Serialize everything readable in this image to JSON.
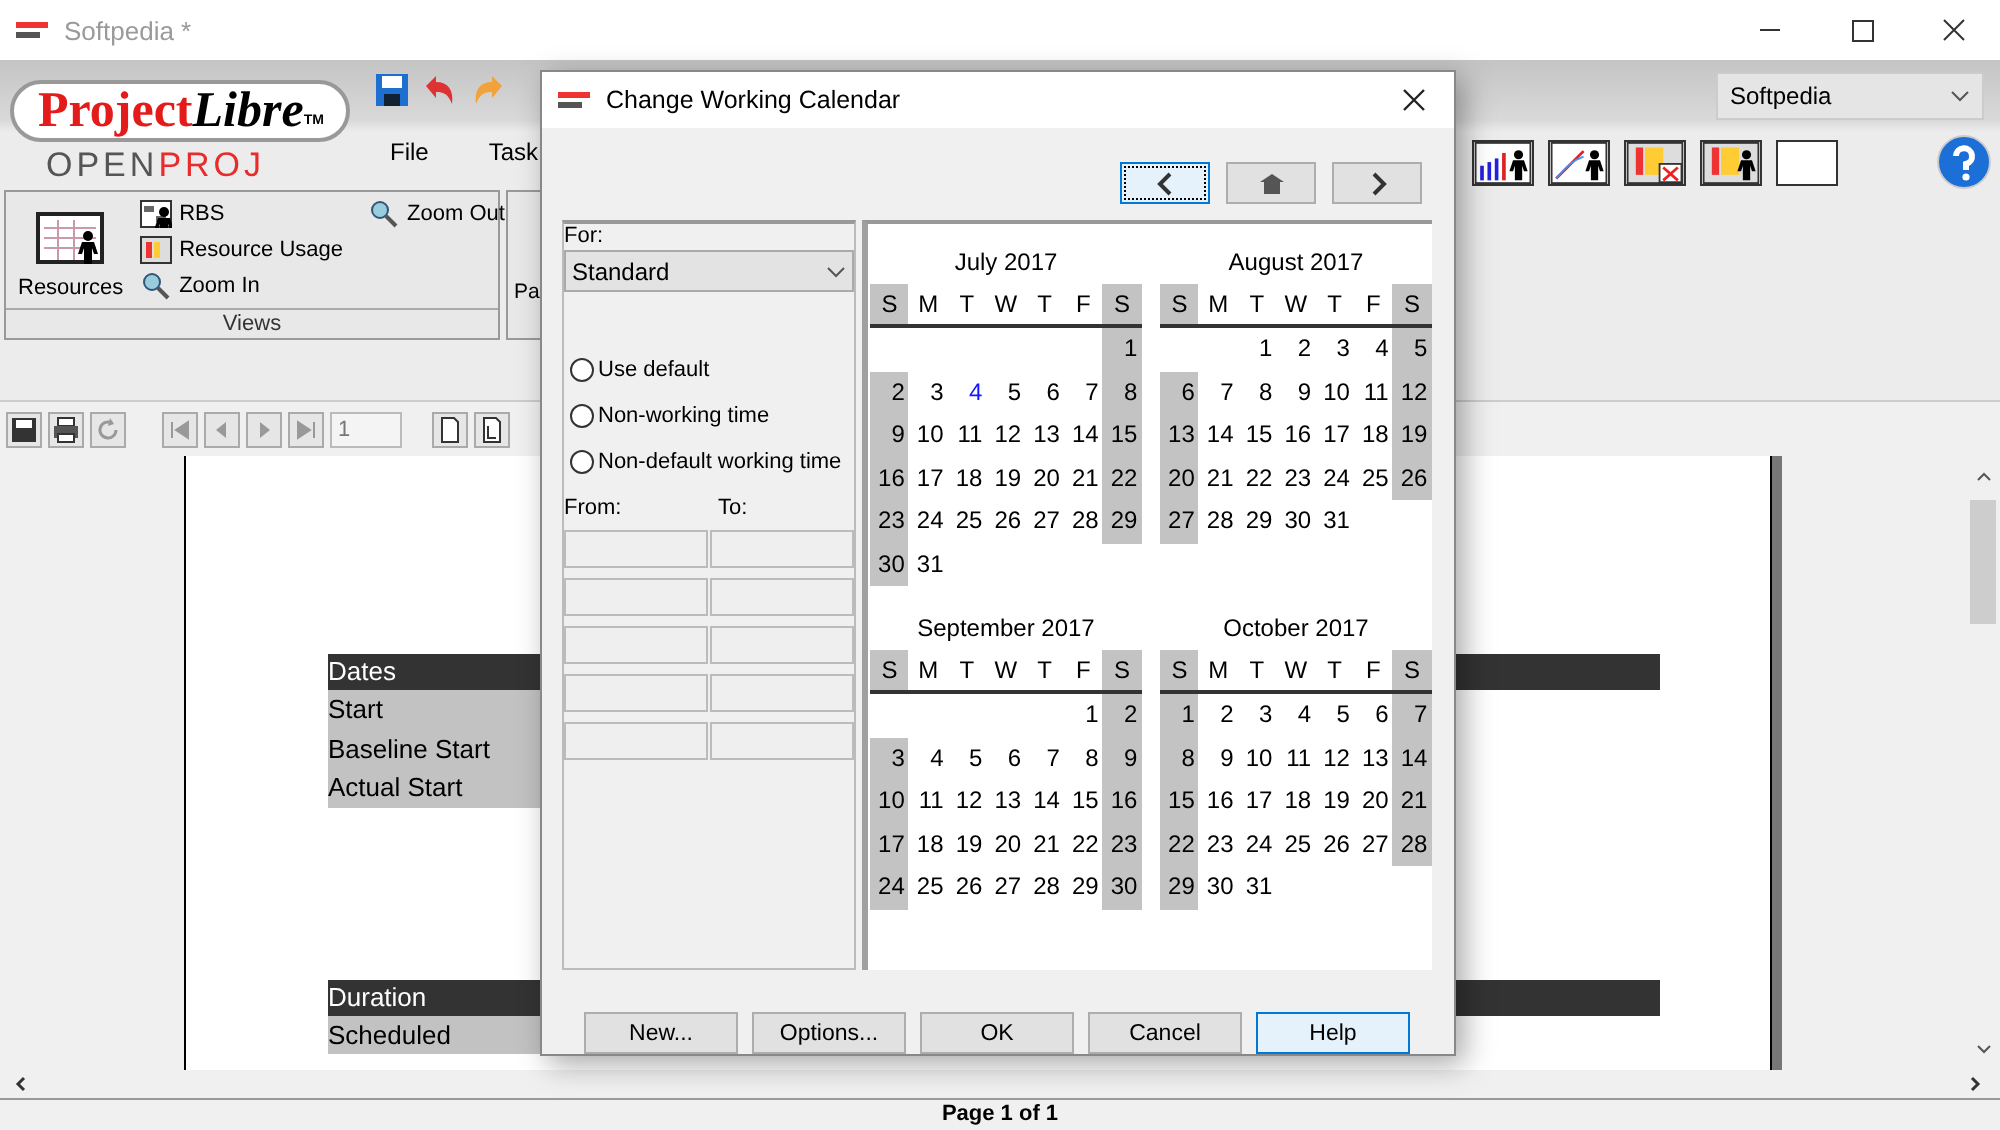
{
  "window": {
    "title": "Softpedia *"
  },
  "ribbon": {
    "logo": {
      "word_1": "Project",
      "word_2": "Libre",
      "mark": "TM",
      "line_2a": "OPEN",
      "line_2b": "PROJ"
    },
    "tabs": [
      {
        "label": "File",
        "selected": false
      },
      {
        "label": "Task",
        "selected": false
      }
    ],
    "project_selector": {
      "value": "Softpedia"
    },
    "views_group": {
      "label": "Views",
      "large_button": "Resources",
      "items": [
        {
          "label": "RBS",
          "kind": "rbs"
        },
        {
          "label": "Resource Usage",
          "kind": "usage"
        },
        {
          "label": "Zoom In",
          "kind": "zoom"
        },
        {
          "label": "Zoom Out",
          "kind": "zoom"
        }
      ]
    },
    "next_group": {
      "label_fragment": "Pa"
    }
  },
  "toolbar": {
    "page_field": "1"
  },
  "document": {
    "sections": [
      {
        "header": "Dates",
        "rows": [
          "Start",
          "Baseline Start",
          "Actual Start"
        ]
      },
      {
        "header": "Duration",
        "rows": [
          "Scheduled"
        ]
      }
    ]
  },
  "status_bar": {
    "text": "Page 1 of 1"
  },
  "dialog": {
    "title": "Change Working Calendar",
    "nav": [
      {
        "kind": "prev",
        "focused": true
      },
      {
        "kind": "home",
        "focused": false
      },
      {
        "kind": "next",
        "focused": false
      }
    ],
    "for_label": "For:",
    "calendar": "Standard",
    "radios": [
      {
        "label": "Use default",
        "selected": false
      },
      {
        "label": "Non-working time",
        "selected": false
      },
      {
        "label": "Non-default working time",
        "selected": false
      }
    ],
    "from_label": "From:",
    "to_label": "To:",
    "months": [
      {
        "title": "July 2017",
        "weekdays": [
          {
            "label": "S",
            "weekend": true
          },
          {
            "label": "M",
            "weekend": false
          },
          {
            "label": "T",
            "weekend": false
          },
          {
            "label": "W",
            "weekend": false
          },
          {
            "label": "T",
            "weekend": false
          },
          {
            "label": "F",
            "weekend": false
          },
          {
            "label": "S",
            "weekend": true
          }
        ],
        "weeks": [
          {
            "partial_start": true,
            "days": [
              "1"
            ]
          },
          {
            "partial_start": false,
            "days": [
              "2",
              "3",
              {
                "text": "4",
                "today": true
              },
              "5",
              "6",
              "7",
              "8"
            ]
          },
          {
            "partial_start": false,
            "days": [
              "9",
              "10",
              "11",
              "12",
              "13",
              "14",
              "15"
            ]
          },
          {
            "partial_start": false,
            "days": [
              "16",
              "17",
              "18",
              "19",
              "20",
              "21",
              "22"
            ]
          },
          {
            "partial_start": false,
            "days": [
              "23",
              "24",
              "25",
              "26",
              "27",
              "28",
              "29"
            ]
          },
          {
            "partial_start": false,
            "days": [
              "30",
              "31"
            ]
          }
        ]
      },
      {
        "title": "August 2017",
        "weekdays": [
          {
            "label": "S",
            "weekend": true
          },
          {
            "label": "M",
            "weekend": false
          },
          {
            "label": "T",
            "weekend": false
          },
          {
            "label": "W",
            "weekend": false
          },
          {
            "label": "T",
            "weekend": false
          },
          {
            "label": "F",
            "weekend": false
          },
          {
            "label": "S",
            "weekend": true
          }
        ],
        "weeks": [
          {
            "partial_start": true,
            "days": [
              "1",
              "2",
              "3",
              "4",
              "5"
            ]
          },
          {
            "partial_start": false,
            "days": [
              "6",
              "7",
              "8",
              "9",
              "10",
              "11",
              "12"
            ]
          },
          {
            "partial_start": false,
            "days": [
              "13",
              "14",
              "15",
              "16",
              "17",
              "18",
              "19"
            ]
          },
          {
            "partial_start": false,
            "days": [
              "20",
              "21",
              "22",
              "23",
              "24",
              "25",
              "26"
            ]
          },
          {
            "partial_start": false,
            "days": [
              "27",
              "28",
              "29",
              "30",
              "31"
            ]
          }
        ]
      },
      {
        "title": "September 2017",
        "weekdays": [
          {
            "label": "S",
            "weekend": true
          },
          {
            "label": "M",
            "weekend": false
          },
          {
            "label": "T",
            "weekend": false
          },
          {
            "label": "W",
            "weekend": false
          },
          {
            "label": "T",
            "weekend": false
          },
          {
            "label": "F",
            "weekend": false
          },
          {
            "label": "S",
            "weekend": true
          }
        ],
        "weeks": [
          {
            "partial_start": true,
            "days": [
              "1",
              "2"
            ]
          },
          {
            "partial_start": false,
            "days": [
              "3",
              "4",
              "5",
              "6",
              "7",
              "8",
              "9"
            ]
          },
          {
            "partial_start": false,
            "days": [
              "10",
              "11",
              "12",
              "13",
              "14",
              "15",
              "16"
            ]
          },
          {
            "partial_start": false,
            "days": [
              "17",
              "18",
              "19",
              "20",
              "21",
              "22",
              "23"
            ]
          },
          {
            "partial_start": false,
            "days": [
              "24",
              "25",
              "26",
              "27",
              "28",
              "29",
              "30"
            ]
          }
        ]
      },
      {
        "title": "October 2017",
        "weekdays": [
          {
            "label": "S",
            "weekend": true
          },
          {
            "label": "M",
            "weekend": false
          },
          {
            "label": "T",
            "weekend": false
          },
          {
            "label": "W",
            "weekend": false
          },
          {
            "label": "T",
            "weekend": false
          },
          {
            "label": "F",
            "weekend": false
          },
          {
            "label": "S",
            "weekend": true
          }
        ],
        "weeks": [
          {
            "partial_start": false,
            "days": [
              "1",
              "2",
              "3",
              "4",
              "5",
              "6",
              "7"
            ]
          },
          {
            "partial_start": false,
            "days": [
              "8",
              "9",
              "10",
              "11",
              "12",
              "13",
              "14"
            ]
          },
          {
            "partial_start": false,
            "days": [
              "15",
              "16",
              "17",
              "18",
              "19",
              "20",
              "21"
            ]
          },
          {
            "partial_start": false,
            "days": [
              "22",
              "23",
              "24",
              "25",
              "26",
              "27",
              "28"
            ]
          },
          {
            "partial_start": false,
            "days": [
              "29",
              "30",
              "31"
            ]
          }
        ]
      }
    ],
    "buttons": [
      {
        "label": "New...",
        "focused": false
      },
      {
        "label": "Options...",
        "focused": false
      },
      {
        "label": "OK",
        "focused": false
      },
      {
        "label": "Cancel",
        "focused": false
      },
      {
        "label": "Help",
        "focused": true
      }
    ]
  }
}
